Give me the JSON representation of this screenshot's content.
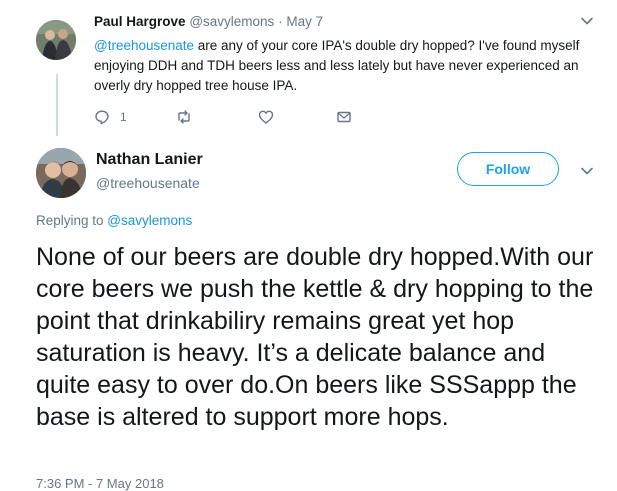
{
  "parent_tweet": {
    "author_name": "Paul Hargrove",
    "handle": "@savylemons",
    "separator": "·",
    "date": "May 7",
    "mention": "@treehousenate",
    "text": " are any of your core IPA's double dry hopped? I've found myself enjoying DDH and TDH beers less and less lately but have never experienced an overly dry hopped tree house IPA.",
    "reply_count": "1",
    "icons": {
      "reply": "reply-icon",
      "retweet": "retweet-icon",
      "like": "heart-icon",
      "dm": "envelope-icon",
      "menu": "chevron-down-icon"
    }
  },
  "main_tweet": {
    "author_name": "Nathan Lanier",
    "handle": "@treehousenate",
    "follow_label": "Follow",
    "replying_to_prefix": "Replying to ",
    "replying_to_handle": "@savylemons",
    "text": "None of our beers are double dry hopped.With our core beers we push the kettle & dry hopping to the point that drinkabiliry remains great yet hop saturation is heavy. It’s a delicate balance and quite easy to over do.On beers like SSSappp the base is altered to support more hops.",
    "timestamp": "7:36 PM - 7 May 2018"
  },
  "colors": {
    "accent": "#1da1f2",
    "link": "#1b95e0",
    "muted_text": "#657786",
    "primary_text": "#14171a",
    "thread_line": "#cfd9de"
  }
}
